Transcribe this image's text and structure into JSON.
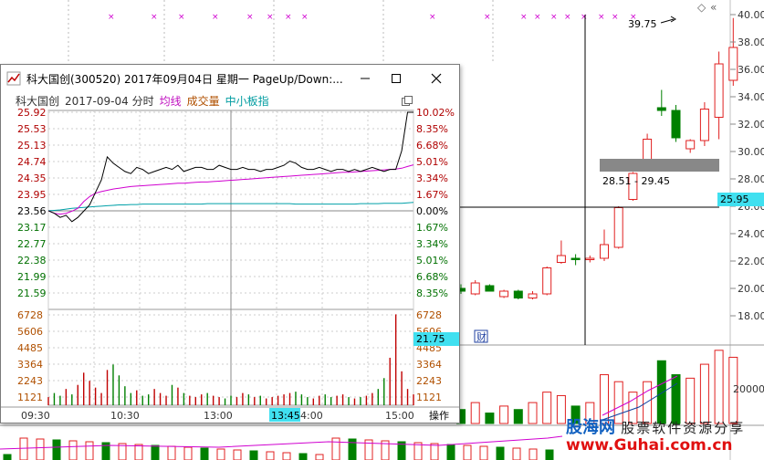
{
  "main_chart": {
    "price_axis": [
      "40.00",
      "38.00",
      "36.00",
      "34.00",
      "32.00",
      "30.00",
      "28.00",
      "26.00",
      "24.00",
      "22.00",
      "20.00",
      "18.00"
    ],
    "volume_axis": [
      "20000"
    ],
    "current_price_badge": "25.95",
    "peak_label": "39.75",
    "gap_label": "28.51 - 29.45",
    "marker_icon": "diamond-icon",
    "event_marker": "财",
    "colors": {
      "up": "#e02020",
      "down": "#008000",
      "crosshair": "#000000",
      "price_badge_bg": "#40e0f0",
      "gap_band": "#888888"
    },
    "candles": [
      {
        "o": 20.0,
        "h": 20.3,
        "l": 19.6,
        "c": 19.8,
        "up": false
      },
      {
        "o": 19.6,
        "h": 20.6,
        "l": 19.5,
        "c": 20.4,
        "up": true
      },
      {
        "o": 20.2,
        "h": 20.3,
        "l": 19.8,
        "c": 19.8,
        "up": false
      },
      {
        "o": 19.4,
        "h": 19.9,
        "l": 19.3,
        "c": 19.8,
        "up": true
      },
      {
        "o": 19.8,
        "h": 19.9,
        "l": 19.2,
        "c": 19.3,
        "up": false
      },
      {
        "o": 19.3,
        "h": 19.8,
        "l": 19.2,
        "c": 19.6,
        "up": true
      },
      {
        "o": 19.6,
        "h": 21.6,
        "l": 19.5,
        "c": 21.5,
        "up": true
      },
      {
        "o": 21.9,
        "h": 23.5,
        "l": 21.8,
        "c": 22.4,
        "up": true
      },
      {
        "o": 22.1,
        "h": 22.5,
        "l": 21.7,
        "c": 22.2,
        "up": false
      },
      {
        "o": 22.1,
        "h": 22.4,
        "l": 21.9,
        "c": 22.2,
        "up": true
      },
      {
        "o": 22.2,
        "h": 24.3,
        "l": 22.0,
        "c": 23.2,
        "up": true
      },
      {
        "o": 23.0,
        "h": 26.0,
        "l": 22.9,
        "c": 25.9,
        "up": true
      },
      {
        "o": 26.5,
        "h": 28.5,
        "l": 26.4,
        "c": 28.4,
        "up": true
      },
      {
        "o": 29.4,
        "h": 31.3,
        "l": 28.8,
        "c": 30.9,
        "up": true
      },
      {
        "o": 33.2,
        "h": 34.5,
        "l": 32.6,
        "c": 33.0,
        "up": false
      },
      {
        "o": 33.0,
        "h": 33.4,
        "l": 30.7,
        "c": 31.0,
        "up": false
      },
      {
        "o": 30.2,
        "h": 30.9,
        "l": 29.9,
        "c": 30.8,
        "up": true
      },
      {
        "o": 30.8,
        "h": 33.6,
        "l": 30.4,
        "c": 33.1,
        "up": true
      },
      {
        "o": 32.5,
        "h": 37.3,
        "l": 30.9,
        "c": 36.4,
        "up": true
      },
      {
        "o": 35.2,
        "h": 39.75,
        "l": 34.8,
        "c": 37.6,
        "up": true
      }
    ],
    "volumes": [
      4000,
      6000,
      3000,
      5000,
      4000,
      6000,
      9000,
      8000,
      5000,
      6000,
      14000,
      12000,
      9000,
      12000,
      18000,
      14000,
      13000,
      17000,
      21000,
      19000
    ]
  },
  "popup": {
    "title": "科大国创(300520) 2017年09月04日 星期一 PageUp/Down:...",
    "stock_name": "科大国创",
    "date": "2017-09-04 分时",
    "legend_avg": "均线",
    "legend_vol": "成交量",
    "legend_index": "中小板指",
    "price_ticks": [
      "25.92",
      "25.53",
      "25.13",
      "24.74",
      "24.35",
      "23.95",
      "23.56",
      "23.17",
      "22.77",
      "22.38",
      "21.99",
      "21.59"
    ],
    "pct_ticks": [
      "10.02%",
      "8.35%",
      "6.68%",
      "5.01%",
      "3.34%",
      "1.67%",
      "0.00%",
      "1.67%",
      "3.34%",
      "5.01%",
      "6.68%",
      "8.35%"
    ],
    "volume_ticks": [
      "6728",
      "5606",
      "4485",
      "3364",
      "2243",
      "1121"
    ],
    "time_ticks": [
      "09:30",
      "10:30",
      "13:00",
      "14:00",
      "15:00"
    ],
    "cursor_time": "13:45",
    "cursor_value": "21.75",
    "operation_label": "操作",
    "colors": {
      "price_line": "#000000",
      "avg_line": "#d000d0",
      "index_line": "#00a0a8",
      "up_label": "#b00000",
      "down_label": "#007000",
      "volume_label": "#b05000",
      "cursor_badge": "#40e0f0"
    },
    "price_series": [
      23.56,
      23.5,
      23.4,
      23.45,
      23.3,
      23.4,
      23.55,
      23.7,
      24.0,
      24.3,
      24.85,
      24.7,
      24.6,
      24.5,
      24.45,
      24.6,
      24.55,
      24.45,
      24.5,
      24.55,
      24.6,
      24.55,
      24.65,
      24.5,
      24.55,
      24.6,
      24.6,
      24.55,
      24.55,
      24.65,
      24.6,
      24.55,
      24.55,
      24.6,
      24.55,
      24.55,
      24.5,
      24.55,
      24.55,
      24.6,
      24.65,
      24.75,
      24.7,
      24.6,
      24.55,
      24.55,
      24.6,
      24.55,
      24.5,
      24.55,
      24.55,
      24.5,
      24.55,
      24.5,
      24.55,
      24.6,
      24.55,
      24.5,
      24.55,
      24.55,
      25.0,
      25.92,
      25.92
    ],
    "avg_series": [
      23.56,
      23.5,
      23.48,
      23.5,
      23.55,
      23.62,
      23.78,
      23.9,
      23.98,
      24.02,
      24.05,
      24.08,
      24.1,
      24.12,
      24.14,
      24.15,
      24.16,
      24.17,
      24.18,
      24.19,
      24.2,
      24.21,
      24.22,
      24.22,
      24.23,
      24.24,
      24.25,
      24.25,
      24.26,
      24.27,
      24.28,
      24.29,
      24.3,
      24.31,
      24.32,
      24.33,
      24.34,
      24.35,
      24.36,
      24.37,
      24.38,
      24.39,
      24.4,
      24.41,
      24.42,
      24.43,
      24.44,
      24.45,
      24.46,
      24.47,
      24.48,
      24.48,
      24.49,
      24.5,
      24.51,
      24.52,
      24.53,
      24.54,
      24.55,
      24.56,
      24.58,
      24.62,
      24.66
    ],
    "index_series": [
      23.56,
      23.57,
      23.58,
      23.6,
      23.62,
      23.63,
      23.64,
      23.65,
      23.66,
      23.67,
      23.68,
      23.69,
      23.7,
      23.7,
      23.71,
      23.71,
      23.72,
      23.72,
      23.72,
      23.72,
      23.72,
      23.72,
      23.72,
      23.72,
      23.72,
      23.72,
      23.72,
      23.73,
      23.73,
      23.73,
      23.73,
      23.73,
      23.73,
      23.73,
      23.73,
      23.73,
      23.73,
      23.73,
      23.73,
      23.73,
      23.73,
      23.73,
      23.72,
      23.72,
      23.72,
      23.72,
      23.72,
      23.72,
      23.72,
      23.72,
      23.72,
      23.72,
      23.72,
      23.73,
      23.73,
      23.73,
      23.73,
      23.74,
      23.74,
      23.74,
      23.74,
      23.75,
      23.76
    ],
    "volume_series": [
      600,
      900,
      700,
      1200,
      800,
      1500,
      2400,
      1800,
      1300,
      900,
      2600,
      3000,
      2200,
      1400,
      900,
      1100,
      700,
      800,
      1200,
      900,
      700,
      1500,
      1300,
      900,
      700,
      600,
      800,
      900,
      700,
      600,
      500,
      700,
      600,
      900,
      800,
      600,
      700,
      500,
      600,
      700,
      800,
      900,
      1000,
      800,
      600,
      500,
      700,
      800,
      600,
      700,
      800,
      600,
      500,
      600,
      700,
      900,
      1200,
      2000,
      3500,
      6700,
      2500,
      1200,
      800
    ]
  },
  "logo": {
    "brand": "股海网",
    "slogan": "股票软件资源分享",
    "url": "www.Guhai.com.cn"
  }
}
